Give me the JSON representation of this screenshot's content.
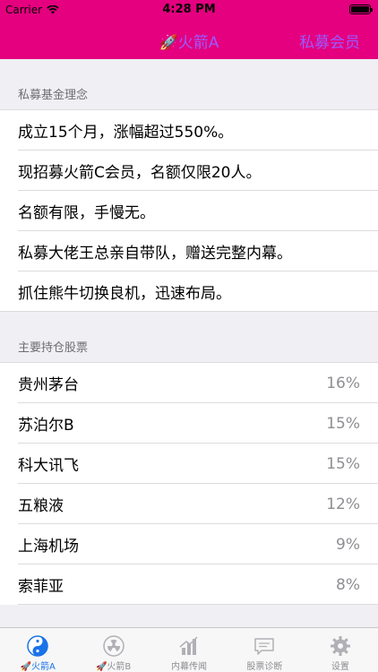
{
  "status_bar": {
    "carrier": "Carrier",
    "time": "4:28 PM"
  },
  "nav": {
    "title": "🚀火箭A",
    "right_button": "私募会员"
  },
  "sections": [
    {
      "header": "私募基金理念",
      "rows": [
        {
          "text": "成立15个月，涨幅超过550%。"
        },
        {
          "text": "现招募火箭C会员，名额仅限20人。"
        },
        {
          "text": "名额有限，手慢无。"
        },
        {
          "text": "私募大佬王总亲自带队，赠送完整内幕。"
        },
        {
          "text": "抓住熊牛切换良机，迅速布局。"
        }
      ]
    },
    {
      "header": "主要持仓股票",
      "rows": [
        {
          "text": "贵州茅台",
          "value": "16%"
        },
        {
          "text": "苏泊尔B",
          "value": "15%"
        },
        {
          "text": "科大讯飞",
          "value": "15%"
        },
        {
          "text": "五粮液",
          "value": "12%"
        },
        {
          "text": "上海机场",
          "value": "9%"
        },
        {
          "text": "索菲亚",
          "value": "8%"
        }
      ]
    }
  ],
  "tabs": [
    {
      "label": "🚀火箭A",
      "icon": "yin-yang-icon",
      "active": true
    },
    {
      "label": "🚀火箭B",
      "icon": "radiation-icon",
      "active": false
    },
    {
      "label": "内幕传闻",
      "icon": "bar-chart-icon",
      "active": false
    },
    {
      "label": "股票诊断",
      "icon": "chat-bubble-icon",
      "active": false
    },
    {
      "label": "设置",
      "icon": "gear-icon",
      "active": false
    }
  ]
}
